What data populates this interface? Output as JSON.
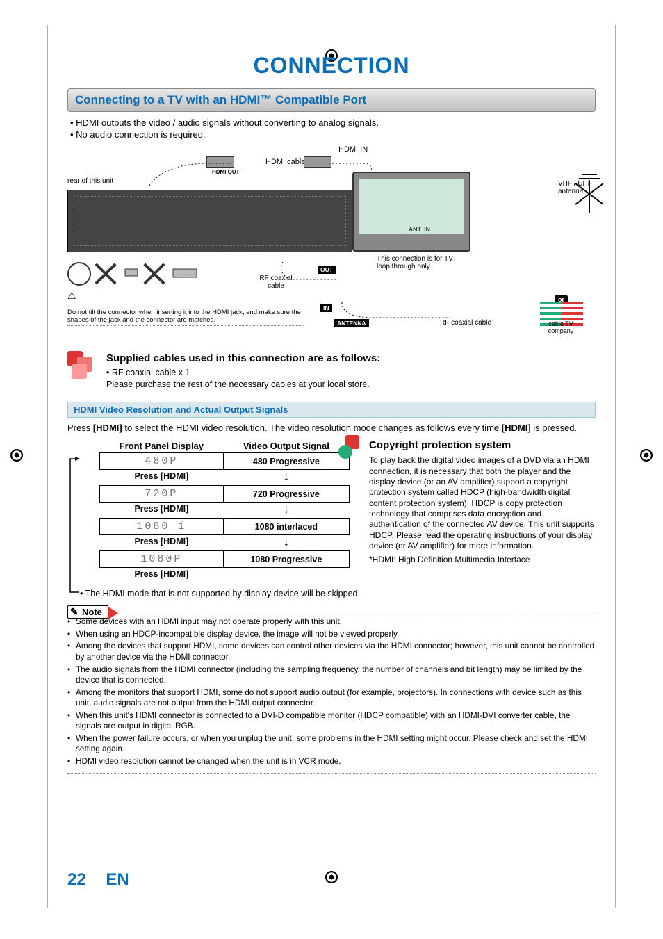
{
  "chapter_title": "CONNECTION",
  "section_title": "Connecting to a TV with an HDMI™ Compatible Port",
  "intro_bullets": [
    "HDMI outputs the video / audio signals without converting to analog signals.",
    "No audio connection is required."
  ],
  "diagram": {
    "hdmi_cable": "HDMI cable",
    "hdmi_in": "HDMI IN",
    "hdmi_out": "HDMI OUT",
    "rear_label": "rear of this unit",
    "ant_in": "ANT. IN",
    "rf_cable": "RF coaxial cable",
    "rf_cable_2": "RF coaxial cable",
    "loop_note": "This connection is for TV loop through only",
    "antenna_label": "VHF / UHF antenna",
    "cable_company": "cable TV company",
    "in_tag": "IN",
    "out_tag": "OUT",
    "antenna_tag": "ANTENNA",
    "or_tag": "or",
    "warning_icon": "⚠",
    "tilt_note": "Do not tilt the connector when inserting it into the HDMI jack, and make sure the shapes of the jack and the connector are matched."
  },
  "supplied": {
    "heading": "Supplied cables used in this connection are as follows:",
    "line1": "• RF coaxial cable x 1",
    "line2": "Please purchase the rest of the necessary cables at your local store."
  },
  "subsection_title": "HDMI Video Resolution and Actual Output Signals",
  "resolution_intro": "Press [HDMI] to select the HDMI video resolution. The video resolution mode changes as follows every time [HDMI] is pressed.",
  "res_table": {
    "col_display": "Front Panel Display",
    "col_signal": "Video Output Signal",
    "rows": [
      {
        "seg": "480P",
        "signal": "480 Progressive"
      },
      {
        "seg": "720P",
        "signal": "720 Progressive"
      },
      {
        "seg": "1080 i",
        "signal": "1080 interlaced"
      },
      {
        "seg": "1080P",
        "signal": "1080 Progressive"
      }
    ],
    "press_label": "Press [HDMI]"
  },
  "skip_note": "• The HDMI mode that is not supported by display device will be skipped.",
  "copyright": {
    "heading": "Copyright protection system",
    "body": "To play back the digital video images of a DVD via an HDMI connection, it is necessary that both the player and the display device (or an AV amplifier) support a copyright protection system called HDCP (high-bandwidth digital content protection system). HDCP is copy protection technology that comprises data encryption and authentication of the connected AV device. This unit supports HDCP. Please read the operating instructions of your display device (or AV amplifier) for more information.",
    "footnote": "*HDMI: High Definition Multimedia Interface"
  },
  "note_label": "Note",
  "notes": [
    "Some devices with an HDMI input may not operate properly with this unit.",
    "When using an HDCP-incompatible display device, the image will not be viewed properly.",
    "Among the devices that support HDMI, some devices can control other devices via the HDMI connector; however, this unit cannot be controlled by another device via the HDMI connector.",
    "The audio signals from the HDMI connector (including the sampling frequency, the number of channels and bit length) may be limited by the device that is connected.",
    "Among the monitors that support HDMI, some do not support audio output (for example, projectors). In connections with device such as this unit, audio signals are not output from the HDMI output connector.",
    "When this unit's HDMI connector is connected to a DVI-D compatible monitor (HDCP compatible) with an HDMI-DVI converter cable, the signals are output in digital RGB.",
    "When the power failure occurs, or when you unplug the unit, some problems in the HDMI setting might occur. Please check and set the HDMI setting again.",
    "HDMI video resolution cannot be changed when the unit is in VCR mode."
  ],
  "footer": {
    "page": "22",
    "lang": "EN"
  }
}
